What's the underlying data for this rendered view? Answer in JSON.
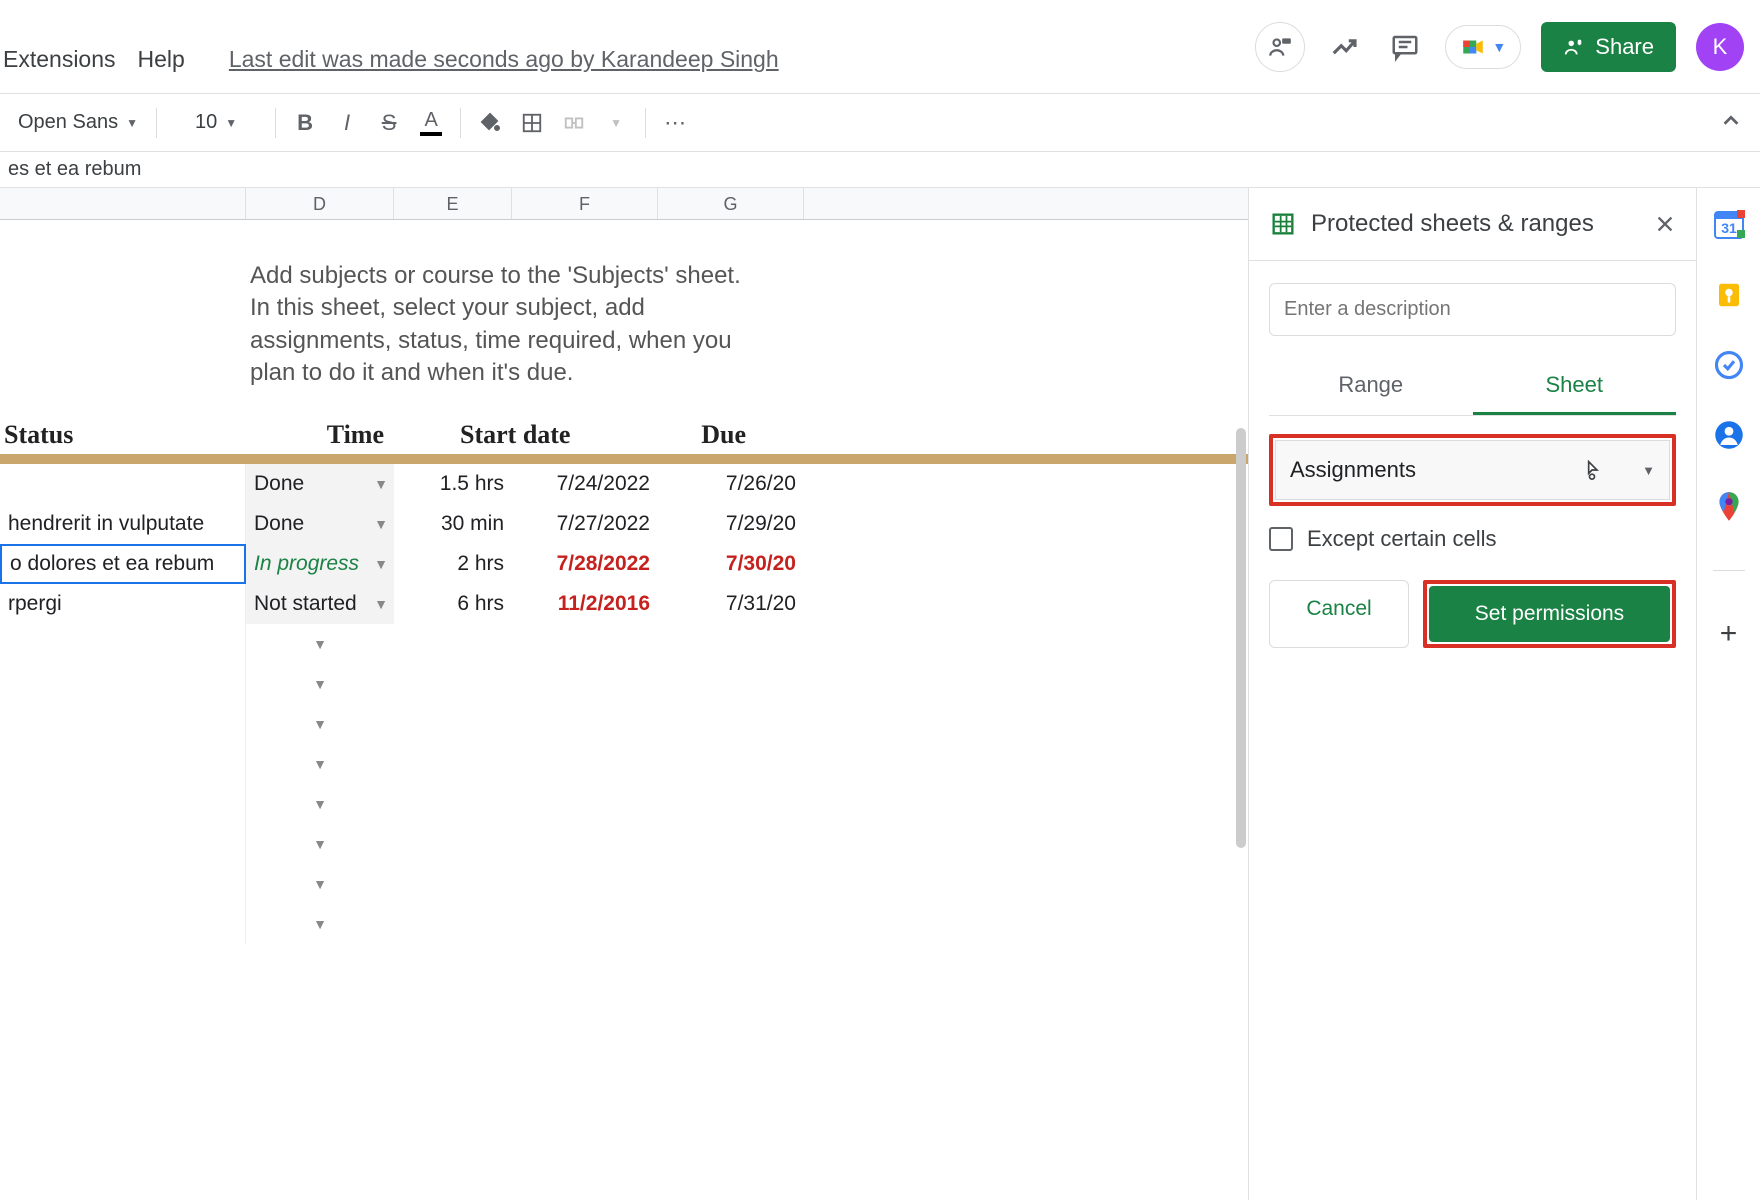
{
  "menubar": {
    "extensions": "Extensions",
    "help": "Help",
    "edit_status": "Last edit was made seconds ago by Karandeep Singh"
  },
  "header": {
    "share_label": "Share",
    "avatar_letter": "K"
  },
  "toolbar": {
    "font_name": "Open Sans",
    "font_size": "10"
  },
  "formula_bar": {
    "value": "es et ea rebum"
  },
  "grid": {
    "columns": [
      "D",
      "E",
      "F",
      "G"
    ],
    "instruction": "Add subjects or course to the 'Subjects' sheet. In this sheet, select your subject, add assignments, status, time required, when you plan to do it and when it's due.",
    "headers": {
      "status": "Status",
      "time": "Time",
      "start_date": "Start date",
      "due": "Due"
    },
    "rows": [
      {
        "desc": "",
        "status": "Done",
        "time": "1.5 hrs",
        "start": "7/24/2022",
        "due": "7/26/20",
        "start_red": false,
        "due_red": false,
        "selected": false,
        "status_style": ""
      },
      {
        "desc": "hendrerit in vulputate",
        "status": "Done",
        "time": "30 min",
        "start": "7/27/2022",
        "due": "7/29/20",
        "start_red": false,
        "due_red": false,
        "selected": false,
        "status_style": ""
      },
      {
        "desc": "o dolores et ea rebum",
        "status": "In progress",
        "time": "2 hrs",
        "start": "7/28/2022",
        "due": "7/30/20",
        "start_red": true,
        "due_red": true,
        "selected": true,
        "status_style": "italic-green"
      },
      {
        "desc": "rpergi",
        "status": "Not started",
        "time": "6 hrs",
        "start": "11/2/2016",
        "due": "7/31/20",
        "start_red": true,
        "due_red": false,
        "selected": false,
        "status_style": ""
      }
    ],
    "empty_status_rows": 8
  },
  "right_panel": {
    "title": "Protected sheets & ranges",
    "description_placeholder": "Enter a description",
    "tab_range": "Range",
    "tab_sheet": "Sheet",
    "sheet_select_value": "Assignments",
    "except_label": "Except certain cells",
    "cancel_label": "Cancel",
    "set_permissions_label": "Set permissions"
  },
  "side_rail": {
    "calendar_day": "31"
  }
}
